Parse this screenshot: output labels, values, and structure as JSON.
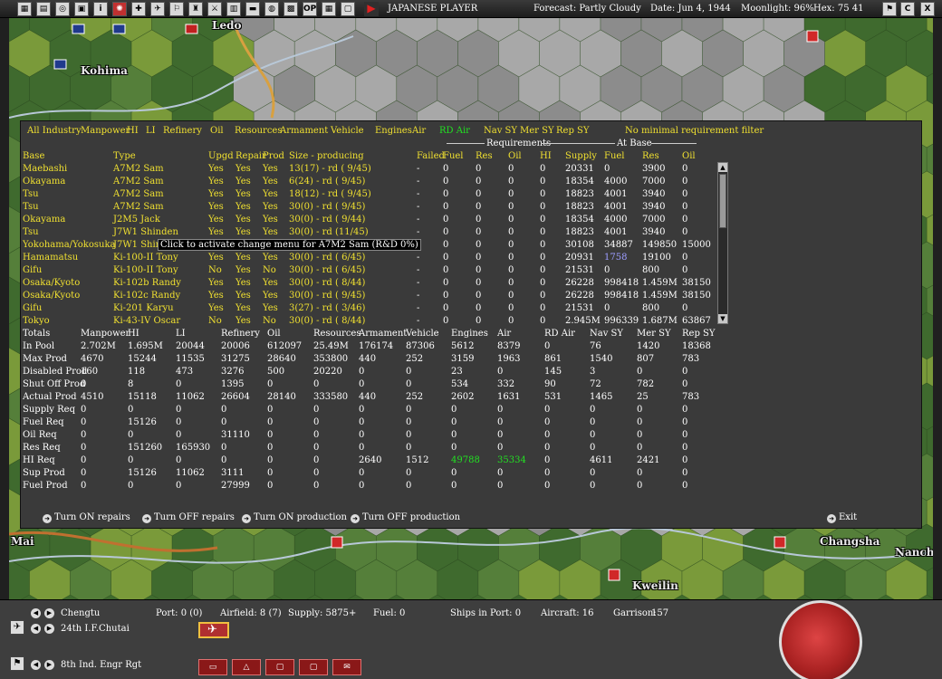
{
  "topbar": {
    "player": "JAPANESE PLAYER",
    "forecast": "Forecast: Partly Cloudy",
    "date": "Date: Jun 4, 1944",
    "moonlight": "Moonlight: 96%",
    "hex": "Hex: 75 41",
    "right_buttons": [
      "⚑",
      "C",
      "X"
    ]
  },
  "map": {
    "labels": [
      "Ledo",
      "Kohima",
      "Mai",
      "Changsha",
      "Nancha",
      "Kweilin"
    ],
    "colors": {
      "forest": "#3f6a2e",
      "plains": "#7a9a3a",
      "mountain": "#a8a8a8",
      "river": "#b8c8d8",
      "border": "#d8a040"
    }
  },
  "tabs": [
    "All Industry",
    "Manpower",
    "HI",
    "LI",
    "Refinery",
    "Oil",
    "Resources",
    "Armament",
    "Vehicle",
    "Engines",
    "Air",
    "RD Air",
    "Nav SY",
    "Mer SY",
    "Rep SY",
    "No minimal requirement filter"
  ],
  "active_tab": "RD Air",
  "group_headers": {
    "requirements": "Requirements",
    "at_base": "At Base"
  },
  "columns": [
    "Base",
    "Type",
    "Upgd",
    "Repair",
    "Prod",
    "Size - producing",
    "Failed",
    "Fuel",
    "Res",
    "Oil",
    "HI",
    "Supply",
    "Fuel",
    "Res",
    "Oil"
  ],
  "rows": [
    [
      "Maebashi",
      "A7M2 Sam",
      "Yes",
      "Yes",
      "Yes",
      "13(17) - rd ( 9/45)",
      "-",
      "0",
      "0",
      "0",
      "0",
      "20331",
      "0",
      "3900",
      "0"
    ],
    [
      "Okayama",
      "A7M2 Sam",
      "Yes",
      "Yes",
      "Yes",
      "6(24) - rd ( 9/45)",
      "-",
      "0",
      "0",
      "0",
      "0",
      "18354",
      "4000",
      "7000",
      "0"
    ],
    [
      "Tsu",
      "A7M2 Sam",
      "Yes",
      "Yes",
      "Yes",
      "18(12) - rd ( 9/45)",
      "-",
      "0",
      "0",
      "0",
      "0",
      "18823",
      "4001",
      "3940",
      "0"
    ],
    [
      "Tsu",
      "A7M2 Sam",
      "Yes",
      "Yes",
      "Yes",
      "30(0) - rd ( 9/45)",
      "-",
      "0",
      "0",
      "0",
      "0",
      "18823",
      "4001",
      "3940",
      "0"
    ],
    [
      "Okayama",
      "J2M5 Jack",
      "Yes",
      "Yes",
      "Yes",
      "30(0) - rd ( 9/44)",
      "-",
      "0",
      "0",
      "0",
      "0",
      "18354",
      "4000",
      "7000",
      "0"
    ],
    [
      "Tsu",
      "J7W1 Shinden",
      "Yes",
      "Yes",
      "Yes",
      "30(0) - rd (11/45)",
      "-",
      "0",
      "0",
      "0",
      "0",
      "18823",
      "4001",
      "3940",
      "0"
    ],
    [
      "Yokohama/Yokosuka",
      "J7W1 Shin",
      "",
      "",
      "",
      "",
      "-",
      "0",
      "0",
      "0",
      "0",
      "30108",
      "34887",
      "149850",
      "15000"
    ],
    [
      "Hamamatsu",
      "Ki-100-II Tony",
      "Yes",
      "Yes",
      "Yes",
      "30(0) - rd ( 6/45)",
      "-",
      "0",
      "0",
      "0",
      "0",
      "20931",
      "1758",
      "19100",
      "0"
    ],
    [
      "Gifu",
      "Ki-100-II Tony",
      "No",
      "Yes",
      "No",
      "30(0) - rd ( 6/45)",
      "-",
      "0",
      "0",
      "0",
      "0",
      "21531",
      "0",
      "800",
      "0"
    ],
    [
      "Osaka/Kyoto",
      "Ki-102b Randy",
      "Yes",
      "Yes",
      "Yes",
      "30(0) - rd ( 8/44)",
      "-",
      "0",
      "0",
      "0",
      "0",
      "26228",
      "998418",
      "1.459M",
      "38150"
    ],
    [
      "Osaka/Kyoto",
      "Ki-102c Randy",
      "Yes",
      "Yes",
      "Yes",
      "30(0) - rd ( 9/45)",
      "-",
      "0",
      "0",
      "0",
      "0",
      "26228",
      "998418",
      "1.459M",
      "38150"
    ],
    [
      "Gifu",
      "Ki-201 Karyu",
      "Yes",
      "Yes",
      "Yes",
      "3(27) - rd ( 3/46)",
      "-",
      "0",
      "0",
      "0",
      "0",
      "21531",
      "0",
      "800",
      "0"
    ],
    [
      "Tokyo",
      "Ki-43-IV Oscar",
      "No",
      "Yes",
      "No",
      "30(0) - rd ( 8/44)",
      "-",
      "0",
      "0",
      "0",
      "0",
      "2.945M",
      "996339",
      "1.687M",
      "63867"
    ]
  ],
  "tooltip": "Click to activate change menu for A7M2 Sam (R&D 0%)",
  "totals_header": [
    "Totals",
    "Manpower",
    "HI",
    "LI",
    "Refinery",
    "Oil",
    "Resources",
    "Armament",
    "Vehicle",
    "Engines",
    "Air",
    "RD Air",
    "Nav SY",
    "Mer SY",
    "Rep SY"
  ],
  "totals": [
    [
      "In Pool",
      "2.702M",
      "1.695M",
      "20044",
      "20006",
      "612097",
      "25.49M",
      "176174",
      "87306",
      "5612",
      "8379",
      "0",
      "76",
      "1420",
      "18368"
    ],
    [
      "Max Prod",
      "4670",
      "15244",
      "11535",
      "31275",
      "28640",
      "353800",
      "440",
      "252",
      "3159",
      "1963",
      "861",
      "1540",
      "807",
      "783"
    ],
    [
      "Disabled Prod",
      "160",
      "118",
      "473",
      "3276",
      "500",
      "20220",
      "0",
      "0",
      "23",
      "0",
      "145",
      "3",
      "0",
      "0"
    ],
    [
      "Shut Off Prod",
      "0",
      "8",
      "0",
      "1395",
      "0",
      "0",
      "0",
      "0",
      "534",
      "332",
      "90",
      "72",
      "782",
      "0"
    ],
    [
      "Actual Prod",
      "4510",
      "15118",
      "11062",
      "26604",
      "28140",
      "333580",
      "440",
      "252",
      "2602",
      "1631",
      "531",
      "1465",
      "25",
      "783"
    ],
    [
      "Supply Req",
      "0",
      "0",
      "0",
      "0",
      "0",
      "0",
      "0",
      "0",
      "0",
      "0",
      "0",
      "0",
      "0",
      "0"
    ],
    [
      "Fuel Req",
      "0",
      "15126",
      "0",
      "0",
      "0",
      "0",
      "0",
      "0",
      "0",
      "0",
      "0",
      "0",
      "0",
      "0"
    ],
    [
      "Oil Req",
      "0",
      "0",
      "0",
      "31110",
      "0",
      "0",
      "0",
      "0",
      "0",
      "0",
      "0",
      "0",
      "0",
      "0"
    ],
    [
      "Res Req",
      "0",
      "151260",
      "165930",
      "0",
      "0",
      "0",
      "0",
      "0",
      "0",
      "0",
      "0",
      "0",
      "0",
      "0"
    ],
    [
      "HI Req",
      "0",
      "0",
      "0",
      "0",
      "0",
      "0",
      "2640",
      "1512",
      "49788",
      "35334",
      "0",
      "4611",
      "2421",
      "0"
    ],
    [
      "Sup Prod",
      "0",
      "15126",
      "11062",
      "3111",
      "0",
      "0",
      "0",
      "0",
      "0",
      "0",
      "0",
      "0",
      "0",
      "0"
    ],
    [
      "Fuel Prod",
      "0",
      "0",
      "0",
      "27999",
      "0",
      "0",
      "0",
      "0",
      "0",
      "0",
      "0",
      "0",
      "0",
      "0"
    ]
  ],
  "actions": [
    "Turn ON repairs",
    "Turn OFF repairs",
    "Turn ON production",
    "Turn OFF production",
    "Exit"
  ],
  "bottom": {
    "base": "Chengtu",
    "port": "Port: 0 (0)",
    "airfield": "Airfield: 8 (7)",
    "supply": "Supply: 5875+",
    "fuel": "Fuel: 0",
    "ships": "Ships in Port: 0",
    "aircraft": "Aircraft: 16",
    "garrison_label": "Garrison:",
    "garrison_value": "157",
    "unit1": "24th I.F.Chutai",
    "unit2": "8th Ind. Engr Rgt"
  }
}
